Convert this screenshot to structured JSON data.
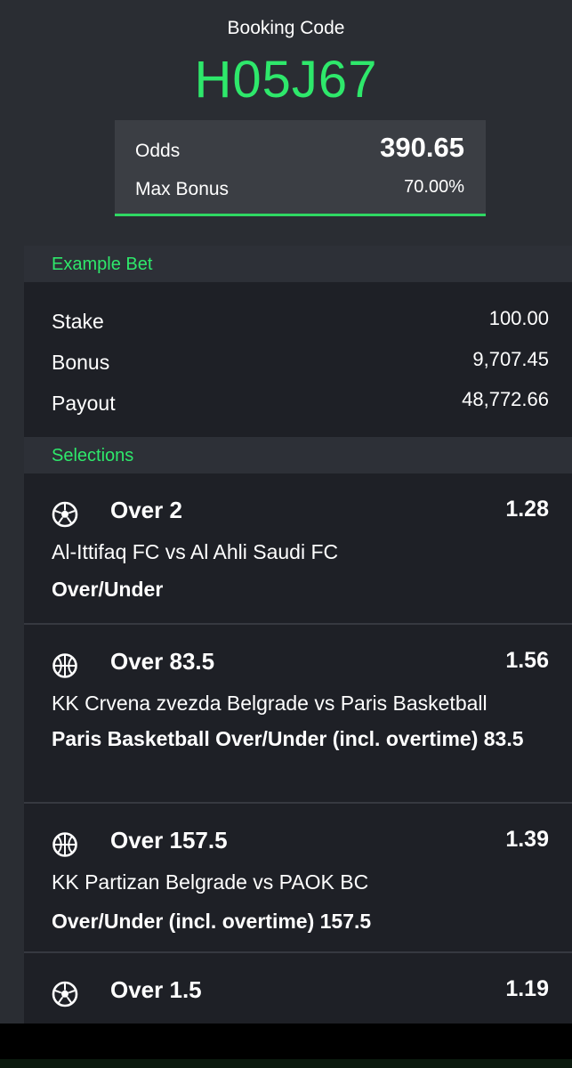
{
  "header": {
    "booking_label": "Booking Code",
    "booking_code": "H05J67",
    "odds_label": "Odds",
    "odds_value": "390.65",
    "max_bonus_label": "Max Bonus",
    "max_bonus_value": "70.00%"
  },
  "example_bet": {
    "title": "Example Bet",
    "rows": [
      {
        "label": "Stake",
        "value": "100.00"
      },
      {
        "label": "Bonus",
        "value": "9,707.45"
      },
      {
        "label": "Payout",
        "value": "48,772.66"
      }
    ]
  },
  "selections": {
    "title": "Selections",
    "items": [
      {
        "sport": "soccer-icon",
        "pick": "Over 2",
        "odds": "1.28",
        "match": "Al-Ittifaq FC vs Al Ahli Saudi FC",
        "market": "Over/Under"
      },
      {
        "sport": "basketball-icon",
        "pick": "Over 83.5",
        "odds": "1.56",
        "match": "KK Crvena zvezda Belgrade vs Paris Basketball",
        "market": "Paris Basketball Over/Under (incl. overtime) 83.5"
      },
      {
        "sport": "basketball-icon",
        "pick": "Over 157.5",
        "odds": "1.39",
        "match": "KK Partizan Belgrade vs PAOK BC",
        "market": "Over/Under (incl. overtime) 157.5"
      },
      {
        "sport": "soccer-icon",
        "pick": "Over 1.5",
        "odds": "1.19",
        "match": "",
        "market": ""
      }
    ]
  },
  "colors": {
    "accent": "#2ee86b",
    "background": "#2a2d33",
    "panel": "#1e2026"
  }
}
